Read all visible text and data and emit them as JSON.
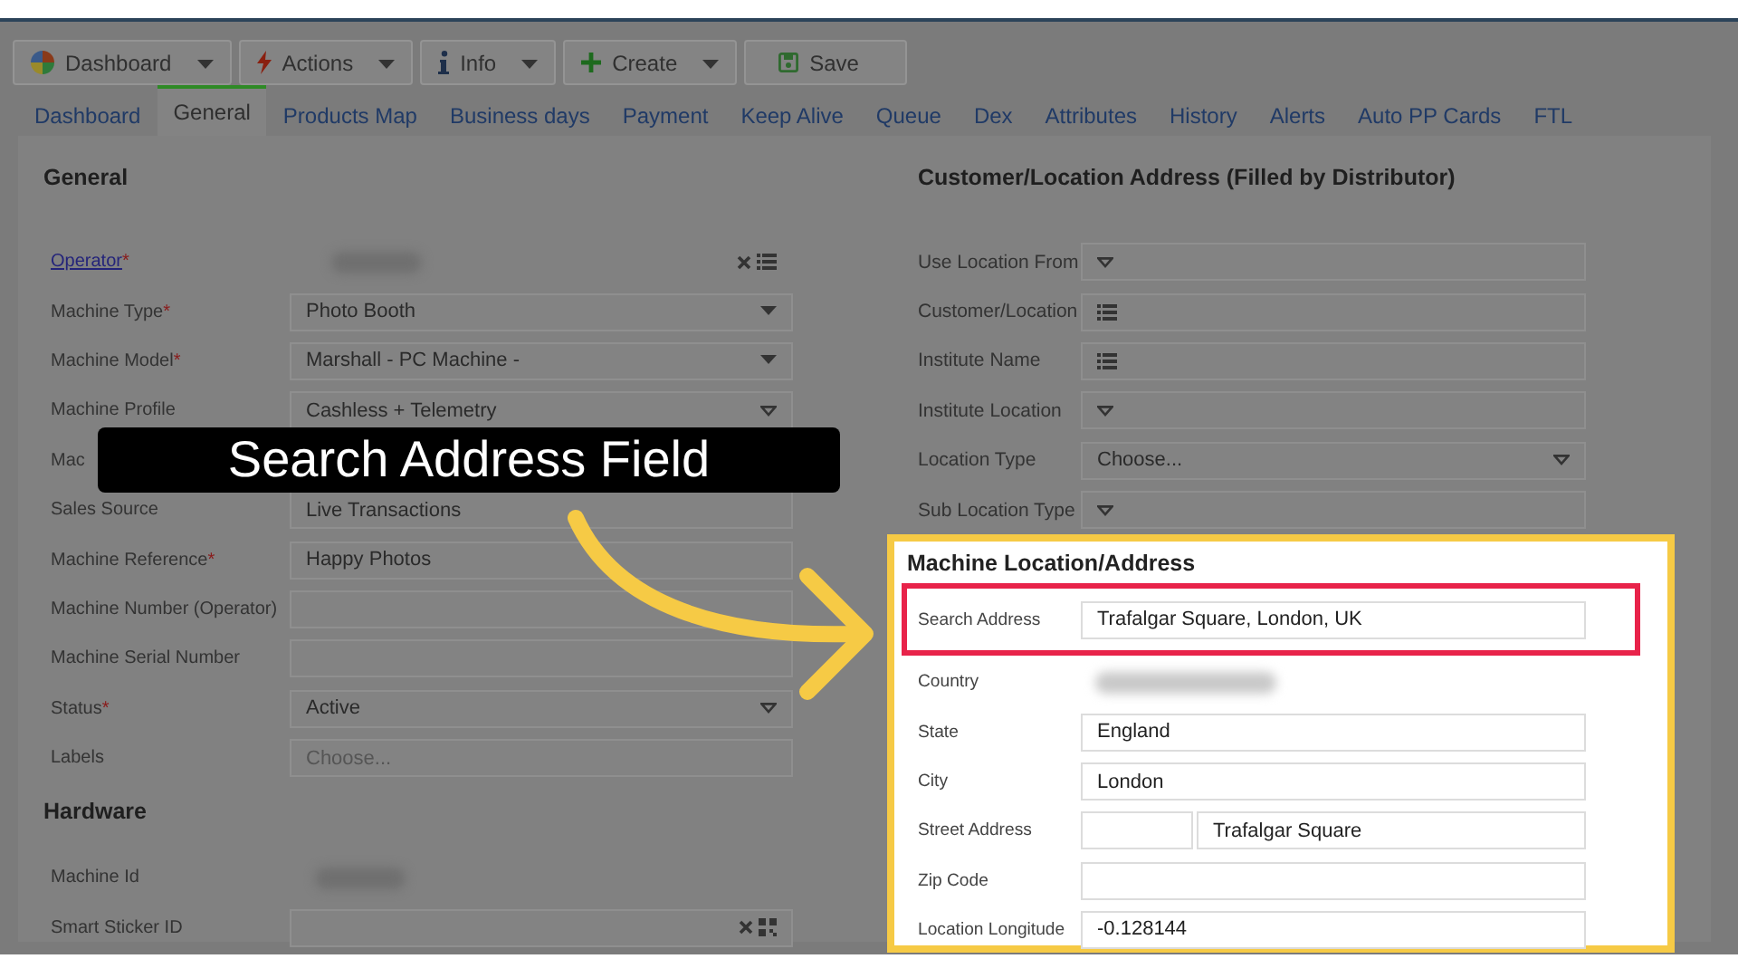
{
  "toolbar": [
    {
      "label": "Dashboard",
      "dropdown": true
    },
    {
      "label": "Actions",
      "dropdown": true
    },
    {
      "label": "Info",
      "dropdown": true
    },
    {
      "label": "Create",
      "dropdown": true
    },
    {
      "label": "Save",
      "dropdown": false
    }
  ],
  "tabs": [
    {
      "label": "Dashboard",
      "selected": false
    },
    {
      "label": "General",
      "selected": true
    },
    {
      "label": "Products Map",
      "selected": false
    },
    {
      "label": "Business days",
      "selected": false
    },
    {
      "label": "Payment",
      "selected": false
    },
    {
      "label": "Keep Alive",
      "selected": false
    },
    {
      "label": "Queue",
      "selected": false
    },
    {
      "label": "Dex",
      "selected": false
    },
    {
      "label": "Attributes",
      "selected": false
    },
    {
      "label": "History",
      "selected": false
    },
    {
      "label": "Alerts",
      "selected": false
    },
    {
      "label": "Auto PP Cards",
      "selected": false
    },
    {
      "label": "FTL",
      "selected": false
    }
  ],
  "general": {
    "title": "General",
    "fields": [
      {
        "label": "Operator",
        "required_mark": "*",
        "link": true,
        "kind": "lookup"
      },
      {
        "label": "Machine Type",
        "required_mark": "*",
        "kind": "select",
        "value": "Photo Booth"
      },
      {
        "label": "Machine Model",
        "required_mark": "*",
        "kind": "select",
        "value": "Marshall - PC Machine -"
      },
      {
        "label": "Machine Profile",
        "kind": "combo",
        "value": "Cashless + Telemetry"
      },
      {
        "label": "Mac",
        "kind": "covered"
      },
      {
        "label": "Sales Source",
        "kind": "text",
        "value": "Live Transactions"
      },
      {
        "label": "Machine Reference",
        "required_mark": "*",
        "kind": "text",
        "value": "Happy Photos"
      },
      {
        "label": "Machine Number (Operator)",
        "kind": "text"
      },
      {
        "label": "Machine Serial Number",
        "kind": "text"
      },
      {
        "label": "Status",
        "required_mark": "*",
        "kind": "combo",
        "value": "Active"
      },
      {
        "label": "Labels",
        "kind": "text",
        "placeholder": "Choose..."
      }
    ]
  },
  "hardware": {
    "title": "Hardware",
    "fields": [
      {
        "label": "Machine Id",
        "kind": "blurred"
      },
      {
        "label": "Smart Sticker ID",
        "kind": "scan"
      }
    ]
  },
  "customer_address": {
    "title": "Customer/Location Address (Filled by Distributor)",
    "fields": [
      {
        "label": "Use Location From",
        "kind": "combo"
      },
      {
        "label": "Customer/Location",
        "kind": "list"
      },
      {
        "label": "Institute Name",
        "kind": "list"
      },
      {
        "label": "Institute Location",
        "kind": "combo"
      },
      {
        "label": "Location Type",
        "kind": "combo",
        "value": "Choose..."
      },
      {
        "label": "Sub Location Type",
        "kind": "combo"
      }
    ]
  },
  "machine_location": {
    "title": "Machine Location/Address",
    "fields": [
      {
        "label": "Search Address",
        "kind": "text",
        "value": "Trafalgar Square, London, UK",
        "highlighted": true
      },
      {
        "label": "Country",
        "kind": "blurred",
        "highlighted": false
      },
      {
        "label": "State",
        "kind": "text",
        "value": "England",
        "highlighted": false
      },
      {
        "label": "City",
        "kind": "text",
        "value": "London",
        "highlighted": false
      },
      {
        "label": "Street Address",
        "kind": "split",
        "value": "Trafalgar Square",
        "highlighted": false
      },
      {
        "label": "Zip Code",
        "kind": "text",
        "highlighted": false
      },
      {
        "label": "Location Longitude",
        "kind": "text",
        "value": "-0.128144",
        "highlighted": false
      }
    ]
  },
  "callout": {
    "label": "Search Address Field"
  }
}
